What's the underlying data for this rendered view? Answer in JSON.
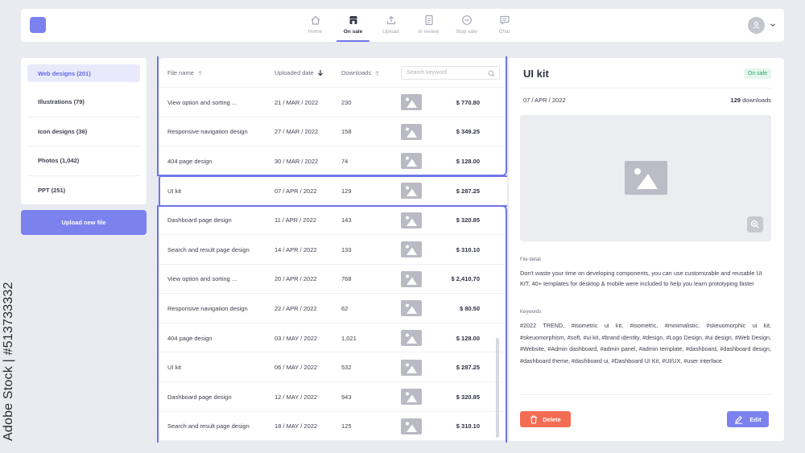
{
  "nav": {
    "items": [
      {
        "label": "Home",
        "icon": "home-icon",
        "active": false
      },
      {
        "label": "On sale",
        "icon": "store-icon",
        "active": true
      },
      {
        "label": "Upload",
        "icon": "upload-icon",
        "active": false
      },
      {
        "label": "In review",
        "icon": "document-icon",
        "active": false
      },
      {
        "label": "Stop sale",
        "icon": "stop-icon",
        "active": false
      },
      {
        "label": "Chat",
        "icon": "chat-icon",
        "active": false
      }
    ]
  },
  "sidebar": {
    "items": [
      {
        "label": "Web designs (201)",
        "active": true
      },
      {
        "label": "Illustrations (79)",
        "active": false
      },
      {
        "label": "Icon designs (36)",
        "active": false
      },
      {
        "label": "Photos (1,042)",
        "active": false
      },
      {
        "label": "PPT (251)",
        "active": false
      }
    ],
    "upload_label": "Upload new file"
  },
  "table": {
    "headers": {
      "file_name": "File name",
      "uploaded_date": "Uploaded date",
      "downloads": "Downloads"
    },
    "search_placeholder": "Search keyword",
    "rows": [
      {
        "name": "View option and sorting ...",
        "date": "21 / MAR / 2022",
        "downloads": "230",
        "price": "$ 770.80"
      },
      {
        "name": "Responsive navigation design",
        "date": "27 / MAR / 2022",
        "downloads": "158",
        "price": "$ 349.25"
      },
      {
        "name": "404 page design",
        "date": "30 / MAR / 2022",
        "downloads": "74",
        "price": "$ 128.00"
      },
      {
        "name": "UI kit",
        "date": "07 / APR / 2022",
        "downloads": "129",
        "price": "$ 287.25"
      },
      {
        "name": "Dashboard page design",
        "date": "11 / APR / 2022",
        "downloads": "143",
        "price": "$ 320.85"
      },
      {
        "name": "Search and result page design",
        "date": "14 / APR / 2022",
        "downloads": "133",
        "price": "$ 310.10"
      },
      {
        "name": "View option and sorting ...",
        "date": "20 / APR / 2022",
        "downloads": "768",
        "price": "$ 2,410.70"
      },
      {
        "name": "Responsive navigation design",
        "date": "22 / APR / 2022",
        "downloads": "62",
        "price": "$ 80.50"
      },
      {
        "name": "404 page design",
        "date": "03 / MAY / 2022",
        "downloads": "1,021",
        "price": "$ 128.00"
      },
      {
        "name": "UI kit",
        "date": "06 / MAY / 2022",
        "downloads": "532",
        "price": "$ 287.25"
      },
      {
        "name": "Dashboard page design",
        "date": "12 / MAY / 2022",
        "downloads": "943",
        "price": "$ 320.85"
      },
      {
        "name": "Search and result page design",
        "date": "18 / MAY / 2022",
        "downloads": "125",
        "price": "$ 310.10"
      }
    ]
  },
  "detail": {
    "title": "UI kit",
    "badge": "On sale",
    "date": "07 / APR / 2022",
    "downloads_count": "129",
    "downloads_suffix": "downloads",
    "file_detail_label": "File detail",
    "file_detail_text": "Don't waste your time on developing components, you can use customizable and reusable UI KIT. 40+ templates for desktop & mobile were included to help you learn prototyping faster",
    "keywords_label": "Keywords",
    "keywords_text": "#2022 TREND, #isometric ui kit, #isometric, #minimalistic, #skeuomorphic ui kit, #skeuomorphism, #soft, #ui kit, #brand identity, #design, #Logo Design, #ui design, #Web Design, #Website, #Admin dashboard, #admin panel, #admin template, #dashboard, #dashboard design, #dashboard theme, #dashboard ui, #Dashboard UI Kit, #UI/UX, #user interface",
    "delete_label": "Delete",
    "edit_label": "Edit"
  },
  "watermark": {
    "vertical_text": "Adobe Stock | #513733332"
  },
  "colors": {
    "accent": "#7b82ee",
    "danger": "#f46c53",
    "success": "#27a56c",
    "background": "#e9ebf1"
  }
}
